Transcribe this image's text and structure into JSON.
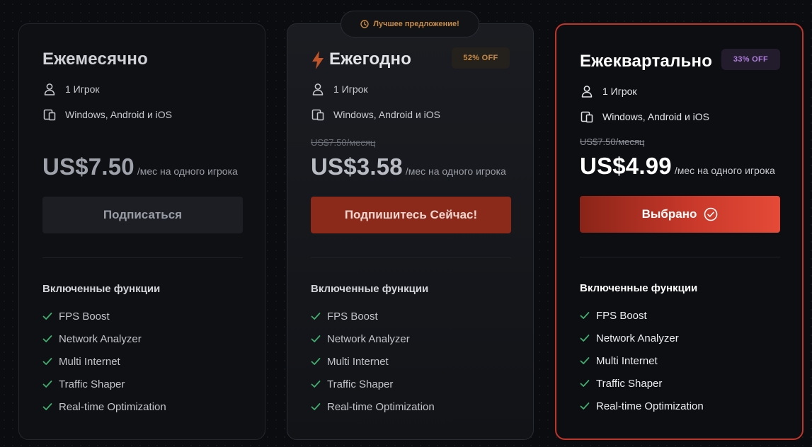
{
  "best_offer_label": "Лучшее предложение!",
  "colors": {
    "accent_red": "#e54a37",
    "check_green": "#3fae6e",
    "badge_orange": "#c98b43",
    "badge_purple": "#b17ee0"
  },
  "plans": [
    {
      "title": "Ежемесячно",
      "badge": "",
      "players": "1 Игрок",
      "platforms": "Windows, Android и iOS",
      "old_price": "",
      "price": "US$7.50",
      "per": "/мес на одного игрока",
      "cta": "Подписаться",
      "features_heading": "Включенные функции",
      "features": [
        "FPS Boost",
        "Network Analyzer",
        "Multi Internet",
        "Traffic Shaper",
        "Real-time Optimization"
      ]
    },
    {
      "title": "Ежегодно",
      "badge": "52% OFF",
      "players": "1 Игрок",
      "platforms": "Windows, Android и iOS",
      "old_price": "US$7.50/месяц",
      "price": "US$3.58",
      "per": "/мес на одного игрока",
      "cta": "Подпишитесь Сейчас!",
      "features_heading": "Включенные функции",
      "features": [
        "FPS Boost",
        "Network Analyzer",
        "Multi Internet",
        "Traffic Shaper",
        "Real-time Optimization"
      ]
    },
    {
      "title": "Ежеквартально",
      "badge": "33% OFF",
      "players": "1 Игрок",
      "platforms": "Windows, Android и iOS",
      "old_price": "US$7.50/месяц",
      "price": "US$4.99",
      "per": "/мес на одного игрока",
      "cta": "Выбрано",
      "selected": true,
      "features_heading": "Включенные функции",
      "features": [
        "FPS Boost",
        "Network Analyzer",
        "Multi Internet",
        "Traffic Shaper",
        "Real-time Optimization"
      ]
    }
  ],
  "icons": {
    "players": "user-icon",
    "platforms": "devices-icon",
    "feature": "check-icon",
    "best_offer": "clock-icon",
    "yearly_title": "lightning-bolt-icon",
    "selected": "check-circle-icon"
  }
}
